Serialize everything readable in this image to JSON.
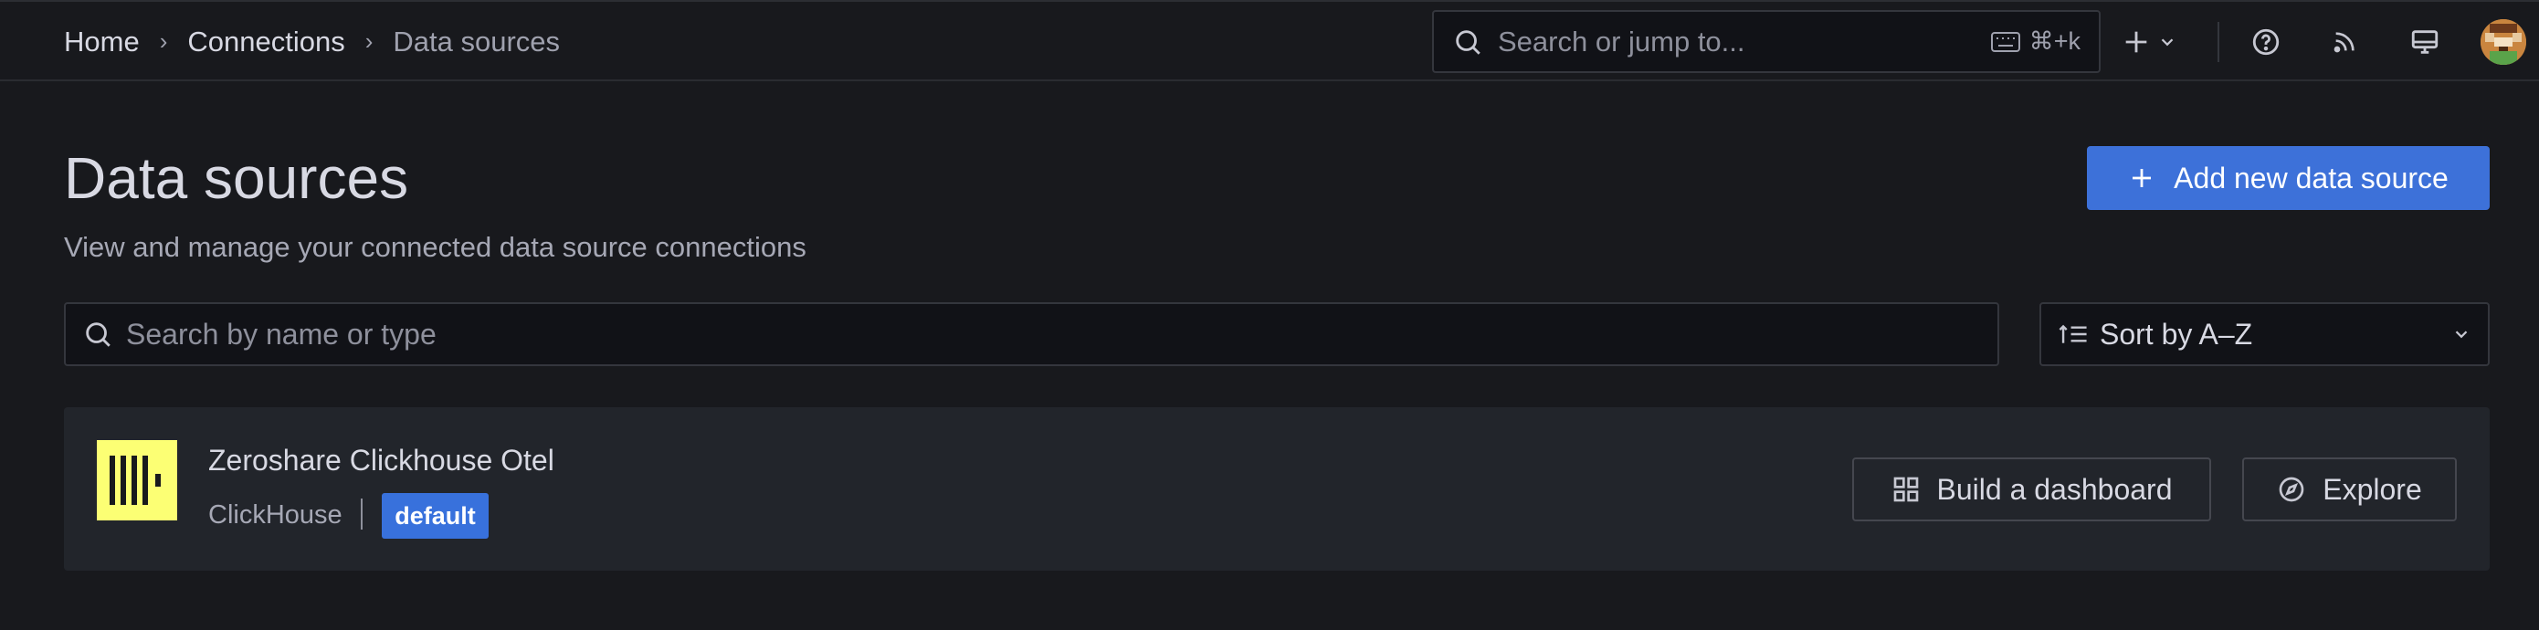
{
  "breadcrumb": {
    "items": [
      "Home",
      "Connections",
      "Data sources"
    ],
    "separator": "›"
  },
  "topbar": {
    "search_placeholder": "Search or jump to...",
    "shortcut": "⌘+k",
    "new_icon": "plus-icon",
    "help_icon": "help-icon",
    "news_icon": "rss-icon",
    "kiosk_icon": "monitor-icon",
    "avatar_icon": "user-avatar"
  },
  "page": {
    "title": "Data sources",
    "subtitle": "View and manage your connected data source connections",
    "add_button_label": "Add new data source",
    "add_button_color": "#3d71d9"
  },
  "filters": {
    "search_placeholder": "Search by name or type",
    "sort_label": "Sort by A–Z"
  },
  "datasources": [
    {
      "name": "Zeroshare Clickhouse Otel",
      "type": "ClickHouse",
      "badge": "default",
      "logo_color": "#fcff74",
      "actions": [
        "Build a dashboard",
        "Explore"
      ]
    }
  ]
}
